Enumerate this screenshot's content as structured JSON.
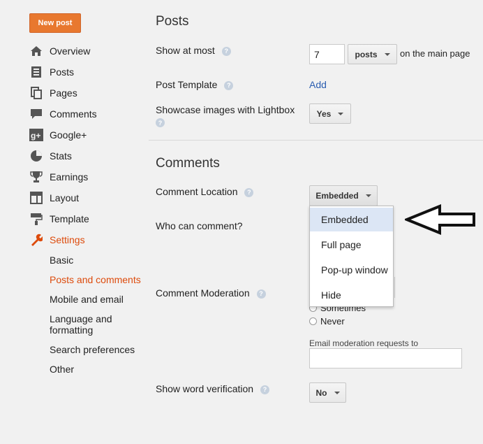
{
  "sidebar": {
    "new_post": "New post",
    "items": [
      {
        "label": "Overview",
        "icon": "home-icon"
      },
      {
        "label": "Posts",
        "icon": "posts-icon"
      },
      {
        "label": "Pages",
        "icon": "pages-icon"
      },
      {
        "label": "Comments",
        "icon": "comment-icon"
      },
      {
        "label": "Google+",
        "icon": "google-plus-icon"
      },
      {
        "label": "Stats",
        "icon": "pie-chart-icon"
      },
      {
        "label": "Earnings",
        "icon": "trophy-icon"
      },
      {
        "label": "Layout",
        "icon": "layout-icon"
      },
      {
        "label": "Template",
        "icon": "paint-roller-icon"
      },
      {
        "label": "Settings",
        "icon": "wrench-icon"
      }
    ],
    "sub_items": [
      {
        "label": "Basic"
      },
      {
        "label": "Posts and comments"
      },
      {
        "label": "Mobile and email"
      },
      {
        "label": "Language and formatting"
      },
      {
        "label": "Search preferences"
      },
      {
        "label": "Other"
      }
    ],
    "active_item": "Settings",
    "active_sub_item": "Posts and comments"
  },
  "posts_section": {
    "title": "Posts",
    "show_at_most": {
      "label": "Show at most",
      "value": "7",
      "unit": "posts",
      "suffix": "on the main page"
    },
    "post_template": {
      "label": "Post Template",
      "action": "Add"
    },
    "lightbox": {
      "label": "Showcase images with Lightbox",
      "value": "Yes"
    }
  },
  "comments_section": {
    "title": "Comments",
    "comment_location": {
      "label": "Comment Location",
      "value": "Embedded",
      "options": [
        "Embedded",
        "Full page",
        "Pop-up window",
        "Hide"
      ],
      "highlighted": "Embedded"
    },
    "who_can_comment": {
      "label": "Who can comment?"
    },
    "moderation": {
      "label": "Comment Moderation",
      "options_visible": [
        "Sometimes",
        "Never"
      ],
      "email_label": "Email moderation requests to",
      "email_value": ""
    },
    "word_verification": {
      "label": "Show word verification",
      "value": "No"
    }
  },
  "help_glyph": "?",
  "colors": {
    "accent_orange": "#e8782f",
    "active_text": "#dd4b0c",
    "link_blue": "#2a5db0",
    "highlight_row": "#dce6f5"
  }
}
